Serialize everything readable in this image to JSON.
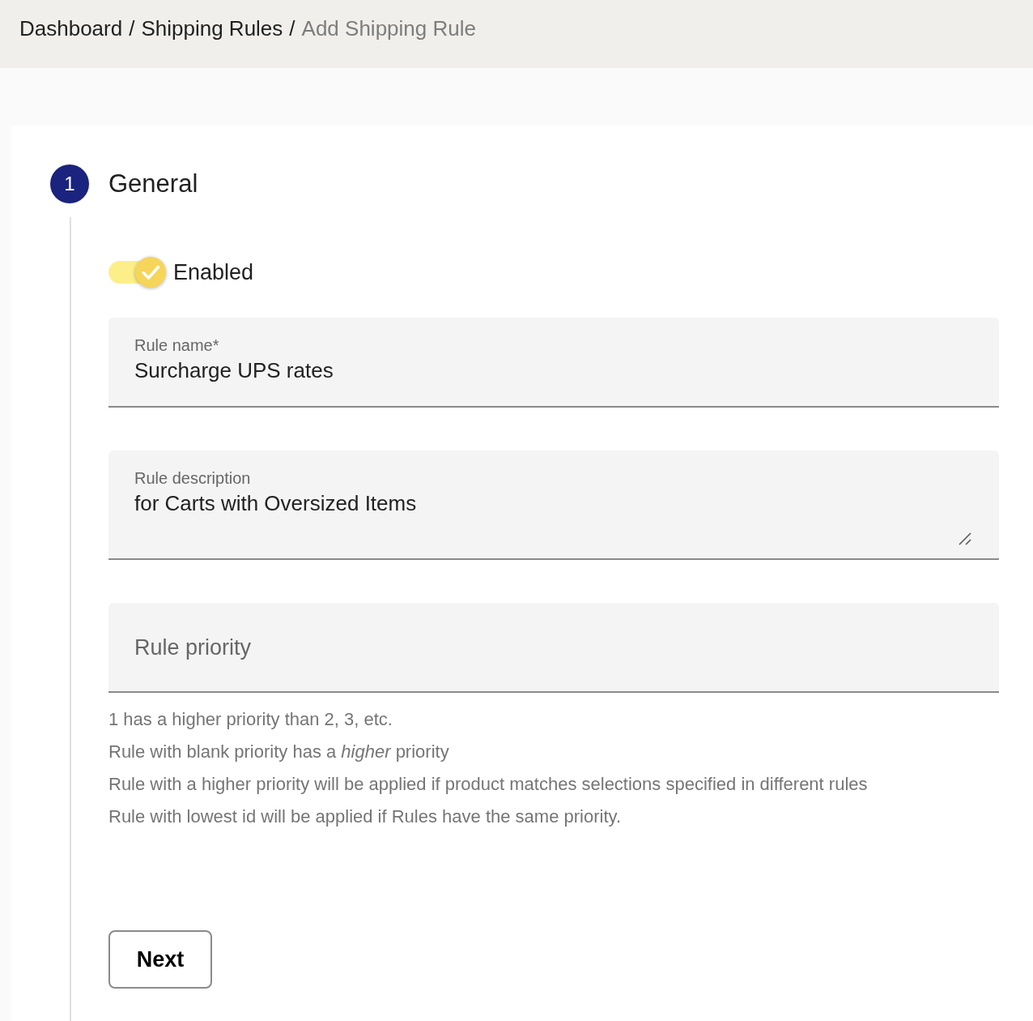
{
  "breadcrumb": {
    "separator": "/",
    "items": [
      {
        "label": "Dashboard",
        "current": false
      },
      {
        "label": "Shipping Rules",
        "current": false
      },
      {
        "label": "Add Shipping Rule",
        "current": true
      }
    ]
  },
  "step": {
    "number": "1",
    "title": "General",
    "active": true
  },
  "toggle": {
    "label": "Enabled",
    "on": true
  },
  "fields": [
    {
      "kind": "input",
      "label": "Rule name*",
      "value": "Surcharge UPS rates"
    },
    {
      "kind": "textarea",
      "label": "Rule description",
      "value": "for Carts with Oversized Items"
    },
    {
      "kind": "input",
      "label": "Rule priority"
    }
  ],
  "hints": [
    "1 has a higher priority than 2, 3, etc.",
    "Rule with blank priority has a *higher* priority",
    "Rule with a higher priority will be applied if product matches selections specified in different rules",
    "Rule with lowest id will be applied if Rules have the same priority."
  ],
  "button": {
    "label": "Next"
  }
}
